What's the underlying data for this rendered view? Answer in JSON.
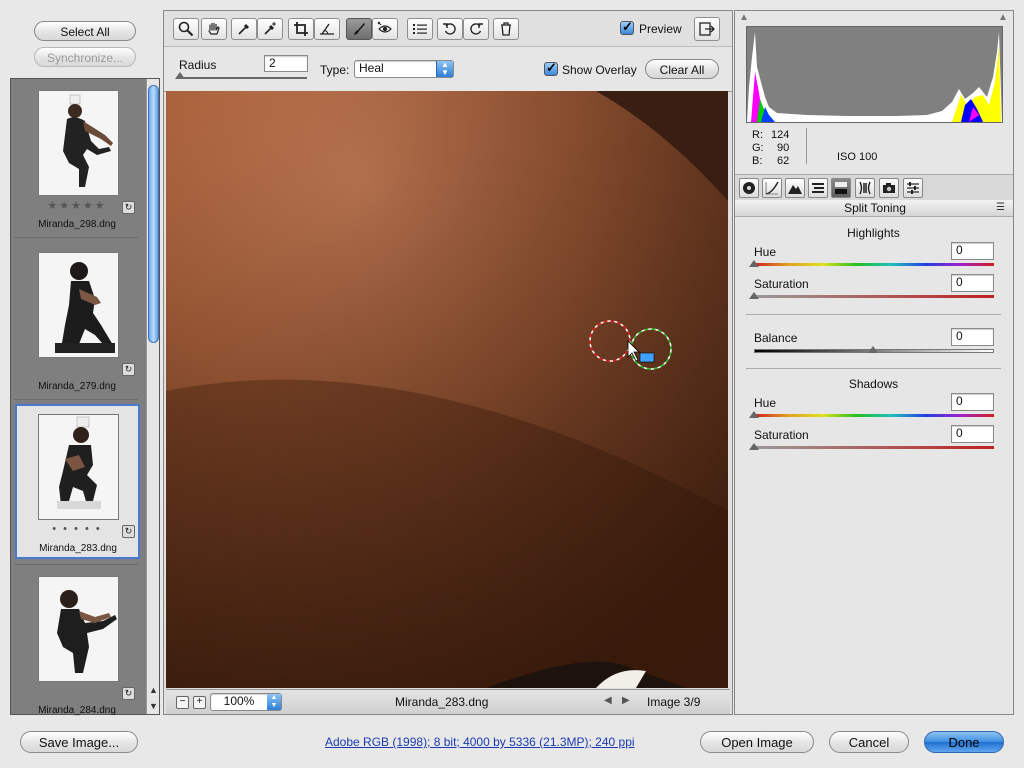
{
  "filmstrip": {
    "select_all": "Select All",
    "synchronize": "Synchronize...",
    "thumbnails": [
      {
        "name": "Miranda_298.dng",
        "rating": "★★★★★",
        "selected": false
      },
      {
        "name": "Miranda_279.dng",
        "rating": "",
        "selected": false
      },
      {
        "name": "Miranda_283.dng",
        "rating": "• • • • •",
        "selected": true
      },
      {
        "name": "Miranda_284.dng",
        "rating": "",
        "selected": false
      }
    ]
  },
  "toolbar": {
    "tools": [
      "zoom-tool",
      "hand-tool",
      "white-balance-tool",
      "color-sampler-tool",
      "crop-tool",
      "straighten-tool",
      "spot-removal-tool",
      "red-eye-tool",
      "preferences",
      "rotate-left",
      "rotate-right",
      "trash"
    ],
    "preview_label": "Preview",
    "preview_checked": true
  },
  "options": {
    "radius_label": "Radius",
    "radius_value": "2",
    "type_label": "Type:",
    "type_value": "Heal",
    "show_overlay_label": "Show Overlay",
    "show_overlay_checked": true,
    "clear_all": "Clear All"
  },
  "statusbar": {
    "zoom": "100%",
    "filename": "Miranda_283.dng",
    "image_counter": "Image 3/9"
  },
  "readout": {
    "r_label": "R:",
    "r_value": "124",
    "g_label": "G:",
    "g_value": "90",
    "b_label": "B:",
    "b_value": "62",
    "iso": "ISO 100"
  },
  "panel": {
    "title": "Split Toning",
    "highlights": {
      "heading": "Highlights",
      "hue_label": "Hue",
      "hue_value": "0",
      "saturation_label": "Saturation",
      "saturation_value": "0"
    },
    "balance": {
      "label": "Balance",
      "value": "0"
    },
    "shadows": {
      "heading": "Shadows",
      "hue_label": "Hue",
      "hue_value": "0",
      "saturation_label": "Saturation",
      "saturation_value": "0"
    }
  },
  "footer": {
    "save_image": "Save Image...",
    "workflow_link": "Adobe RGB (1998); 8 bit; 4000 by 5336 (21.3MP); 240 ppi",
    "open_image": "Open Image",
    "cancel": "Cancel",
    "done": "Done"
  },
  "colors": {
    "accent": "#3d8de0",
    "skin_highlight": "#c6784e",
    "skin_shadow": "#5e3218"
  }
}
